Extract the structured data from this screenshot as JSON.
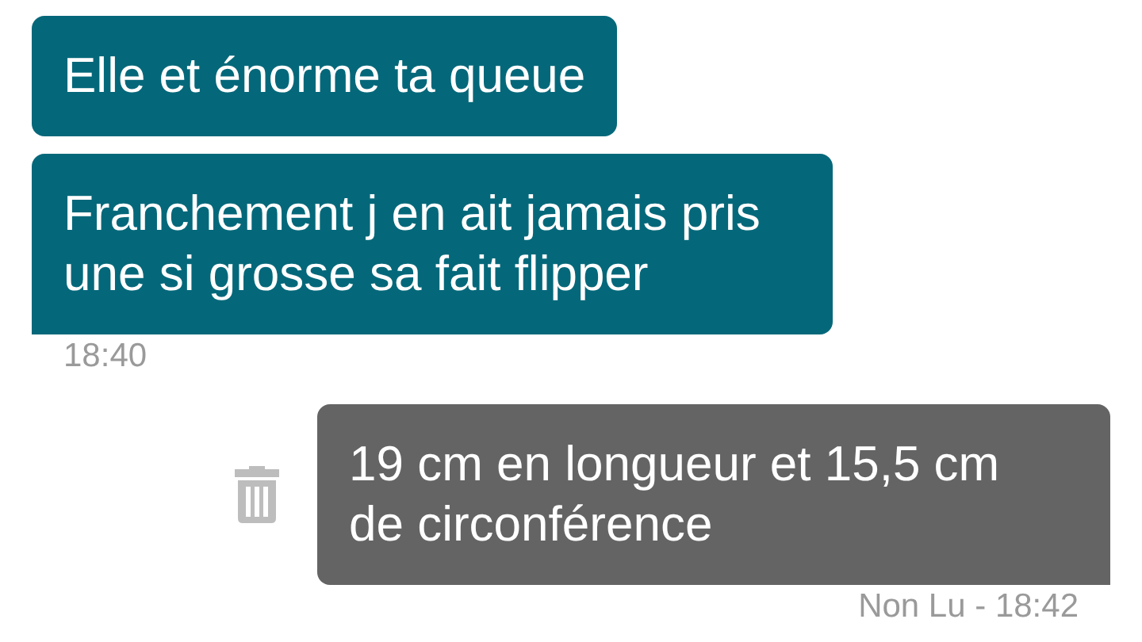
{
  "messages": [
    {
      "kind": "incoming",
      "text": "Elle et énorme ta queue"
    },
    {
      "kind": "incoming",
      "text": "Franchement j en ait jamais pris une si grosse sa fait flipper",
      "meta": "18:40"
    },
    {
      "kind": "outgoing",
      "text": "19 cm en longueur et 15,5 cm de circonférence",
      "meta": "Non Lu - 18:42",
      "deletable": true
    }
  ]
}
